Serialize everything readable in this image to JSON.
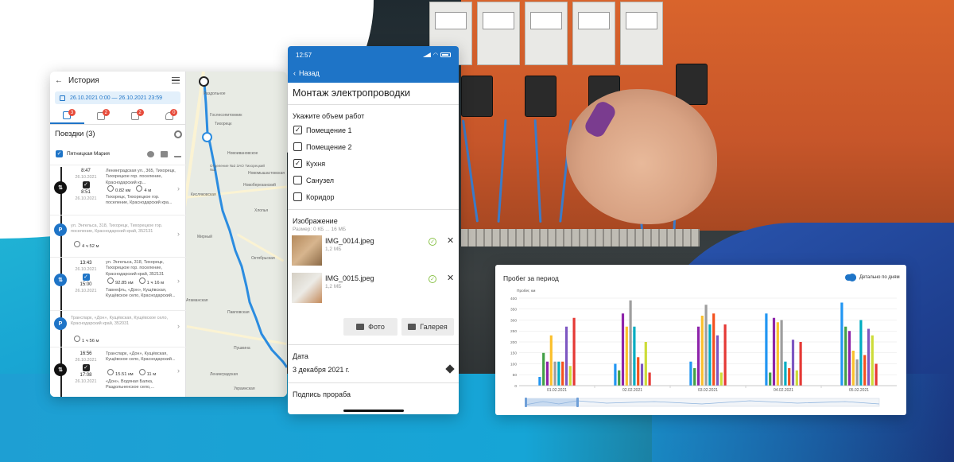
{
  "history": {
    "title": "История",
    "date_range": "26.10.2021 0:00 — 26.10.2021 23:59",
    "tabs": [
      {
        "icon": "route-icon",
        "badge": "3"
      },
      {
        "icon": "report-icon",
        "badge": "2"
      },
      {
        "icon": "checklist-icon",
        "badge": "2"
      },
      {
        "icon": "bell-icon",
        "badge": "0"
      }
    ],
    "trips_label": "Поездки (3)",
    "person": "Пятницкая Мария",
    "items": [
      {
        "type": "trip",
        "start_time": "8:47",
        "start_date": "26.10.2021",
        "end_time": "8:51",
        "end_date": "26.10.2021",
        "from": "Ленинградская ул., 365, Тихорецк, Тихорецкое гор. поселение, Краснодарский кр...",
        "to": "Тихорецк, Тихорецкое гор. поселение, Краснодарский кра...",
        "distance": "0.82 км",
        "duration": "4 м"
      },
      {
        "type": "parking",
        "address": "ул. Энгельса, 318, Тихорецк, Тихорецкое гор. поселение, Краснодарский край, 352131",
        "duration": "4 ч 52 м"
      },
      {
        "type": "trip",
        "start_time": "13:43",
        "start_date": "26.10.2021",
        "end_time": "15:00",
        "end_date": "26.10.2021",
        "from": "ул. Энгельса, 318, Тихорецк, Тихорецкое гор. поселение, Краснодарский край, 352131",
        "to": "Тавнефть, «Дон», Кущёвская, Кущёвское село, Краснодарский...",
        "distance": "92.85 км",
        "duration": "1 ч 16 м"
      },
      {
        "type": "parking",
        "address": "Транспарк, «Дон», Кущёвская, Кущёвское село, Краснодарский край, 352031",
        "duration": "1 ч 56 м"
      },
      {
        "type": "trip",
        "start_time": "16:56",
        "start_date": "26.10.2021",
        "end_time": "17:08",
        "end_date": "26.10.2021",
        "from": "Транспарк, «Дон», Кущёвская, Кущёвское село, Краснодарский...",
        "to": "«Дон», Водяная Балка, Раздольненское село,...",
        "distance": "15.51 км",
        "duration": "11 м"
      }
    ],
    "map_labels": [
      "Раздольное",
      "Тихорецк",
      "Новоивановское",
      "Отделение №2 ЗАО Тихорецкий №2",
      "Кисляковская",
      "Новоберезанский",
      "Хлопья",
      "Мирный",
      "Октябрьская",
      "Павловская",
      "Пушкина",
      "Ленинградская",
      "Украинская",
      "Атаманская",
      "Новомышастовская",
      "Гослесопитомник"
    ]
  },
  "phone": {
    "time": "12:57",
    "back_label": "Назад",
    "title": "Монтаж электропроводки",
    "scope_label": "Укажите объем работ",
    "options": [
      {
        "label": "Помещение 1",
        "checked": true
      },
      {
        "label": "Помещение 2",
        "checked": false
      },
      {
        "label": "Кухня",
        "checked": true
      },
      {
        "label": "Санузел",
        "checked": false
      },
      {
        "label": "Коридор",
        "checked": false
      }
    ],
    "image_label": "Изображение",
    "size_note": "Размер: 0 КБ ... 16 МБ",
    "images": [
      {
        "name": "IMG_0014.jpeg",
        "size": "1,2 МБ"
      },
      {
        "name": "IMG_0015.jpeg",
        "size": "1,2 МБ"
      }
    ],
    "photo_button": "Фото",
    "gallery_button": "Галерея",
    "date_label": "Дата",
    "date_value": "3 декабря 2021 г.",
    "signature_label": "Подпись прораба"
  },
  "chart_card": {
    "title": "Пробег за период",
    "toggle_label": "Детально по дням"
  },
  "chart_data": {
    "type": "bar",
    "title": "Пробег за период",
    "ylabel": "Пробег, км",
    "ylim": [
      0,
      400
    ],
    "yticks": [
      0,
      50,
      100,
      150,
      200,
      250,
      300,
      350,
      400
    ],
    "categories": [
      "01.02.2021",
      "02.02.2021",
      "03.02.2021",
      "04.02.2021",
      "05.02.2021"
    ],
    "series_colors": [
      "#2196f3",
      "#43a047",
      "#8e24aa",
      "#fbc02d",
      "#9e9e9e",
      "#00acc1",
      "#f4511e",
      "#7e57c2",
      "#cddc39",
      "#e53935"
    ],
    "groups": [
      [
        40,
        150,
        110,
        230,
        110,
        110,
        110,
        270,
        90,
        310
      ],
      [
        100,
        70,
        330,
        270,
        390,
        270,
        130,
        100,
        200,
        60
      ],
      [
        110,
        80,
        270,
        320,
        370,
        280,
        330,
        230,
        60,
        280
      ],
      [
        330,
        60,
        310,
        290,
        300,
        110,
        80,
        210,
        70,
        200
      ],
      [
        380,
        270,
        250,
        160,
        120,
        300,
        140,
        260,
        230,
        100
      ]
    ]
  },
  "colors": {
    "brand": "#1e74c7",
    "accent_teal": "#19a6d3",
    "badge": "#e74c3c",
    "ok": "#8bc34a"
  }
}
